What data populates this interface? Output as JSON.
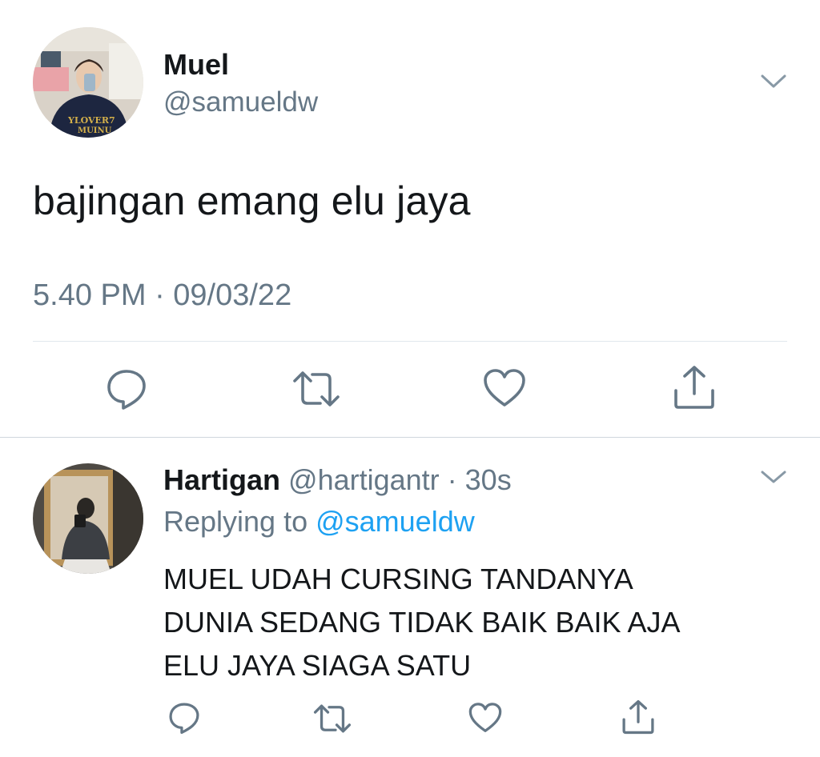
{
  "main_tweet": {
    "name": "Muel",
    "handle": "@samueldw",
    "text": "bajingan emang elu jaya",
    "timestamp": "5.40 PM · 09/03/22",
    "actions": [
      "reply-icon",
      "retweet-icon",
      "like-icon",
      "share-icon"
    ]
  },
  "reply_tweet": {
    "name": "Hartigan",
    "handle_time": " @hartigantr · 30s",
    "replying_prefix": "Replying to ",
    "replying_handle": "@samueldw",
    "text_lines": [
      "MUEL UDAH CURSING TANDANYA",
      "DUNIA SEDANG TIDAK BAIK BAIK AJA",
      "ELU JAYA SIAGA SATU"
    ],
    "actions": [
      "reply-icon",
      "retweet-icon",
      "like-icon",
      "share-icon"
    ]
  },
  "colors": {
    "text": "#14171a",
    "secondary": "#657786",
    "link": "#1da1f2",
    "divider": "#e1e8ed"
  }
}
